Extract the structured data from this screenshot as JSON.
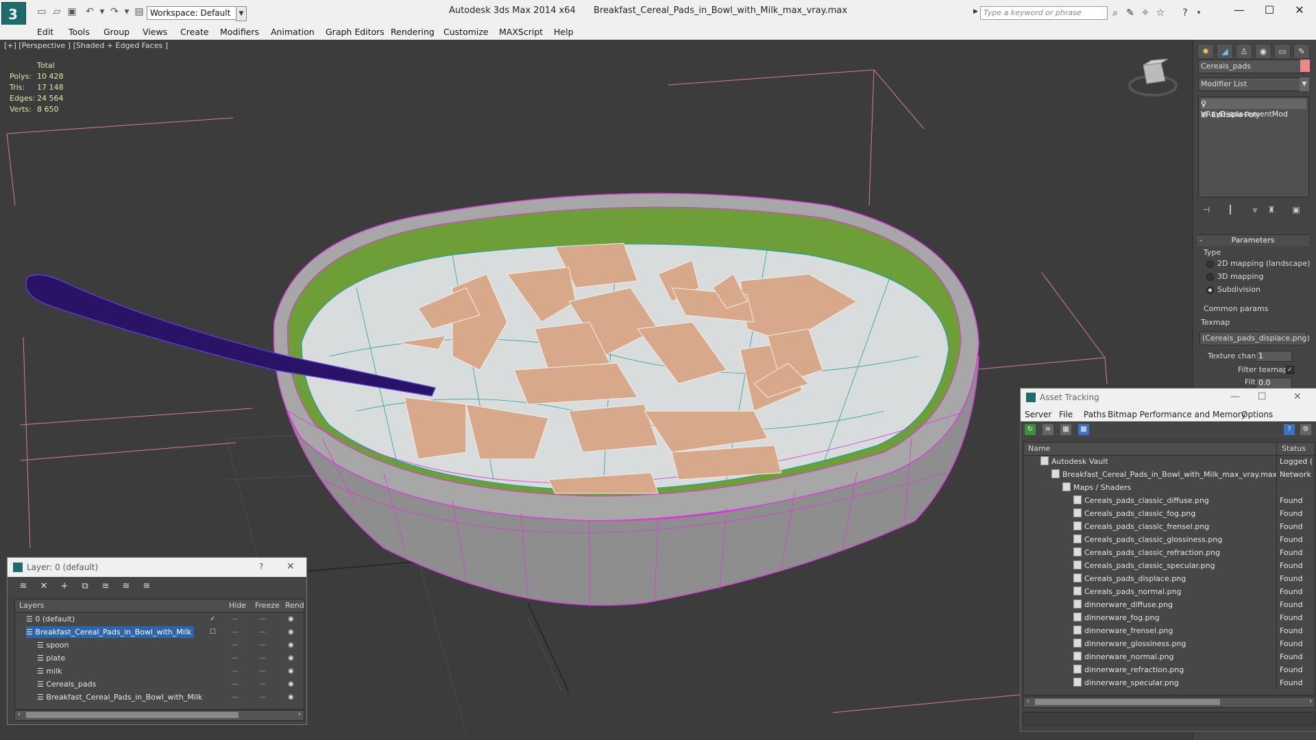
{
  "app": {
    "title": "Autodesk 3ds Max  2014 x64",
    "file": "Breakfast_Cereal_Pads_in_Bowl_with_Milk_max_vray.max",
    "workspace": "Workspace: Default",
    "search_placeholder": "Type a keyword or phrase"
  },
  "menu": [
    "Edit",
    "Tools",
    "Group",
    "Views",
    "Create",
    "Modifiers",
    "Animation",
    "Graph Editors",
    "Rendering",
    "Customize",
    "MAXScript",
    "Help"
  ],
  "viewport": {
    "label": "[+] [Perspective ] [Shaded + Edged Faces ]",
    "stats_header": "Total",
    "stats": [
      {
        "k": "Polys:",
        "v": "10 428"
      },
      {
        "k": "Tris:",
        "v": "17 148"
      },
      {
        "k": "Edges:",
        "v": "24 564"
      },
      {
        "k": "Verts:",
        "v": "8 650"
      }
    ]
  },
  "command_panel": {
    "object_name": "Cereals_pads",
    "modifier_list": "Modifier List",
    "stack": [
      "VRayDisplacementMod",
      "Editable Poly"
    ],
    "parameters_title": "Parameters",
    "type_label": "Type",
    "type_options": [
      "2D mapping (landscape)",
      "3D mapping",
      "Subdivision"
    ],
    "common_params": "Common params",
    "texmap_label": "Texmap",
    "texmap_value": "(Cereals_pads_displace.png)",
    "texture_chan_label": "Texture chan",
    "texture_chan_value": "1",
    "filter_texmap_label": "Filter texmap",
    "filter_blur_label": "Filter blur",
    "filter_blur_value": "0.0"
  },
  "asset_tracking": {
    "title": "Asset Tracking",
    "menu": [
      "Server",
      "File",
      "Paths",
      "Bitmap Performance and Memory",
      "Options"
    ],
    "col_name": "Name",
    "col_status": "Status",
    "rows": [
      {
        "name": "Autodesk Vault",
        "status": "Logged (",
        "indent": 1
      },
      {
        "name": "Breakfast_Cereal_Pads_in_Bowl_with_Milk_max_vray.max",
        "status": "Network",
        "indent": 2
      },
      {
        "name": "Maps / Shaders",
        "status": "",
        "indent": 3
      },
      {
        "name": "Cereals_pads_classic_diffuse.png",
        "status": "Found",
        "indent": 4
      },
      {
        "name": "Cereals_pads_classic_fog.png",
        "status": "Found",
        "indent": 4
      },
      {
        "name": "Cereals_pads_classic_frensel.png",
        "status": "Found",
        "indent": 4
      },
      {
        "name": "Cereals_pads_classic_glossiness.png",
        "status": "Found",
        "indent": 4
      },
      {
        "name": "Cereals_pads_classic_refraction.png",
        "status": "Found",
        "indent": 4
      },
      {
        "name": "Cereals_pads_classic_specular.png",
        "status": "Found",
        "indent": 4
      },
      {
        "name": "Cereals_pads_displace.png",
        "status": "Found",
        "indent": 4
      },
      {
        "name": "Cereals_pads_normal.png",
        "status": "Found",
        "indent": 4
      },
      {
        "name": "dinnerware_diffuse.png",
        "status": "Found",
        "indent": 4
      },
      {
        "name": "dinnerware_fog.png",
        "status": "Found",
        "indent": 4
      },
      {
        "name": "dinnerware_frensel.png",
        "status": "Found",
        "indent": 4
      },
      {
        "name": "dinnerware_glossiness.png",
        "status": "Found",
        "indent": 4
      },
      {
        "name": "dinnerware_normal.png",
        "status": "Found",
        "indent": 4
      },
      {
        "name": "dinnerware_refraction.png",
        "status": "Found",
        "indent": 4
      },
      {
        "name": "dinnerware_specular.png",
        "status": "Found",
        "indent": 4
      }
    ]
  },
  "layer_window": {
    "title": "Layer: 0 (default)",
    "col_layers": "Layers",
    "col_hide": "Hide",
    "col_freeze": "Freeze",
    "col_render": "Render",
    "rows": [
      {
        "name": "0 (default)",
        "selected": false,
        "indent": 1
      },
      {
        "name": "Breakfast_Cereal_Pads_in_Bowl_with_Milk",
        "selected": true,
        "indent": 1
      },
      {
        "name": "spoon",
        "selected": false,
        "indent": 2
      },
      {
        "name": "plate",
        "selected": false,
        "indent": 2
      },
      {
        "name": "milk",
        "selected": false,
        "indent": 2
      },
      {
        "name": "Cereals_pads",
        "selected": false,
        "indent": 2
      },
      {
        "name": "Breakfast_Cereal_Pads_in_Bowl_with_Milk",
        "selected": false,
        "indent": 2
      }
    ]
  },
  "colors": {
    "viewport_bg": "#3c3c3c",
    "grid_line": "#d87aa6",
    "bowl_wire": "#d83fd8",
    "bowl_inner": "#6e9e38",
    "milk": "#d9dcdc",
    "milk_wire": "#1fa39a",
    "spoon": "#3b1f86",
    "cereal": "#d7a98a",
    "selection": "#2d64b0"
  }
}
